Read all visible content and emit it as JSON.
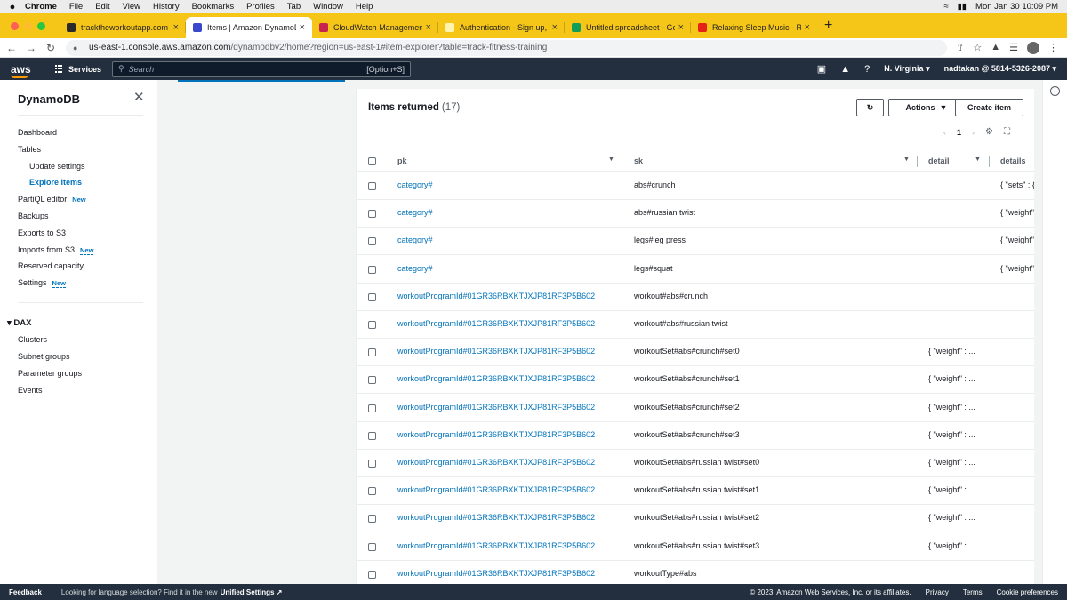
{
  "menubar": {
    "apple": "",
    "app": "Chrome",
    "items": [
      "File",
      "Edit",
      "View",
      "History",
      "Bookmarks",
      "Profiles",
      "Tab",
      "Window",
      "Help"
    ],
    "clock": "Mon Jan 30  10:09 PM"
  },
  "tabs": [
    {
      "label": "tracktheworkoutapp.com",
      "color": "#2b2b2b",
      "active": false
    },
    {
      "label": "Items | Amazon DynamoDB Ma",
      "color": "#3b48cc",
      "active": true
    },
    {
      "label": "CloudWatch Management Con",
      "color": "#c7254e",
      "active": false
    },
    {
      "label": "Authentication - Sign up, Sign",
      "color": "#f5c518",
      "active": false
    },
    {
      "label": "Untitled spreadsheet - Google",
      "color": "#0f9d58",
      "active": false
    },
    {
      "label": "Relaxing Sleep Music - Ra",
      "color": "#e62117",
      "active": false
    }
  ],
  "address": {
    "host": "us-east-1.console.aws.amazon.com",
    "path": "/dynamodbv2/home?region=us-east-1#item-explorer?table=track-fitness-training"
  },
  "awsnav": {
    "logo": "aws",
    "services": "Services",
    "search_placeholder": "Search",
    "search_shortcut": "[Option+S]",
    "region": "N. Virginia",
    "account": "nadtakan @ 5814-5326-2087"
  },
  "sidenav": {
    "title": "DynamoDB",
    "items": {
      "dashboard": "Dashboard",
      "tables": "Tables",
      "update_settings": "Update settings",
      "explore_items": "Explore items",
      "partiql": "PartiQL editor",
      "backups": "Backups",
      "exports": "Exports to S3",
      "imports": "Imports from S3",
      "reserved": "Reserved capacity",
      "settings": "Settings"
    },
    "badge_new": "New",
    "dax_header": "DAX",
    "dax_items": {
      "clusters": "Clusters",
      "subnet": "Subnet groups",
      "parameter": "Parameter groups",
      "events": "Events"
    }
  },
  "panel": {
    "title": "Items returned",
    "count": "(17)",
    "actions_label": "Actions",
    "create_label": "Create item",
    "page_number": "1",
    "columns": {
      "pk": "pk",
      "sk": "sk",
      "detail": "detail",
      "details": "details"
    }
  },
  "rows": [
    {
      "pk": "category#",
      "sk": "abs#crunch",
      "detail": "",
      "details": "{ \"sets\" : {"
    },
    {
      "pk": "category#",
      "sk": "abs#russian twist",
      "detail": "",
      "details": "{ \"weight\""
    },
    {
      "pk": "category#",
      "sk": "legs#leg press",
      "detail": "",
      "details": "{ \"weight\""
    },
    {
      "pk": "category#",
      "sk": "legs#squat",
      "detail": "",
      "details": "{ \"weight\""
    },
    {
      "pk": "workoutProgramId#01GR36RBXKTJXJP81RF3P5B602",
      "sk": "workout#abs#crunch",
      "detail": "",
      "details": ""
    },
    {
      "pk": "workoutProgramId#01GR36RBXKTJXJP81RF3P5B602",
      "sk": "workout#abs#russian twist",
      "detail": "",
      "details": ""
    },
    {
      "pk": "workoutProgramId#01GR36RBXKTJXJP81RF3P5B602",
      "sk": "workoutSet#abs#crunch#set0",
      "detail": "{ \"weight\" : ...",
      "details": ""
    },
    {
      "pk": "workoutProgramId#01GR36RBXKTJXJP81RF3P5B602",
      "sk": "workoutSet#abs#crunch#set1",
      "detail": "{ \"weight\" : ...",
      "details": ""
    },
    {
      "pk": "workoutProgramId#01GR36RBXKTJXJP81RF3P5B602",
      "sk": "workoutSet#abs#crunch#set2",
      "detail": "{ \"weight\" : ...",
      "details": ""
    },
    {
      "pk": "workoutProgramId#01GR36RBXKTJXJP81RF3P5B602",
      "sk": "workoutSet#abs#crunch#set3",
      "detail": "{ \"weight\" : ...",
      "details": ""
    },
    {
      "pk": "workoutProgramId#01GR36RBXKTJXJP81RF3P5B602",
      "sk": "workoutSet#abs#russian twist#set0",
      "detail": "{ \"weight\" : ...",
      "details": ""
    },
    {
      "pk": "workoutProgramId#01GR36RBXKTJXJP81RF3P5B602",
      "sk": "workoutSet#abs#russian twist#set1",
      "detail": "{ \"weight\" : ...",
      "details": ""
    },
    {
      "pk": "workoutProgramId#01GR36RBXKTJXJP81RF3P5B602",
      "sk": "workoutSet#abs#russian twist#set2",
      "detail": "{ \"weight\" : ...",
      "details": ""
    },
    {
      "pk": "workoutProgramId#01GR36RBXKTJXJP81RF3P5B602",
      "sk": "workoutSet#abs#russian twist#set3",
      "detail": "{ \"weight\" : ...",
      "details": ""
    },
    {
      "pk": "workoutProgramId#01GR36RBXKTJXJP81RF3P5B602",
      "sk": "workoutType#abs",
      "detail": "",
      "details": ""
    }
  ],
  "footer": {
    "feedback": "Feedback",
    "lang_text": "Looking for language selection? Find it in the new",
    "unified": "Unified Settings",
    "copyright": "© 2023, Amazon Web Services, Inc. or its affiliates.",
    "privacy": "Privacy",
    "terms": "Terms",
    "cookies": "Cookie preferences"
  }
}
